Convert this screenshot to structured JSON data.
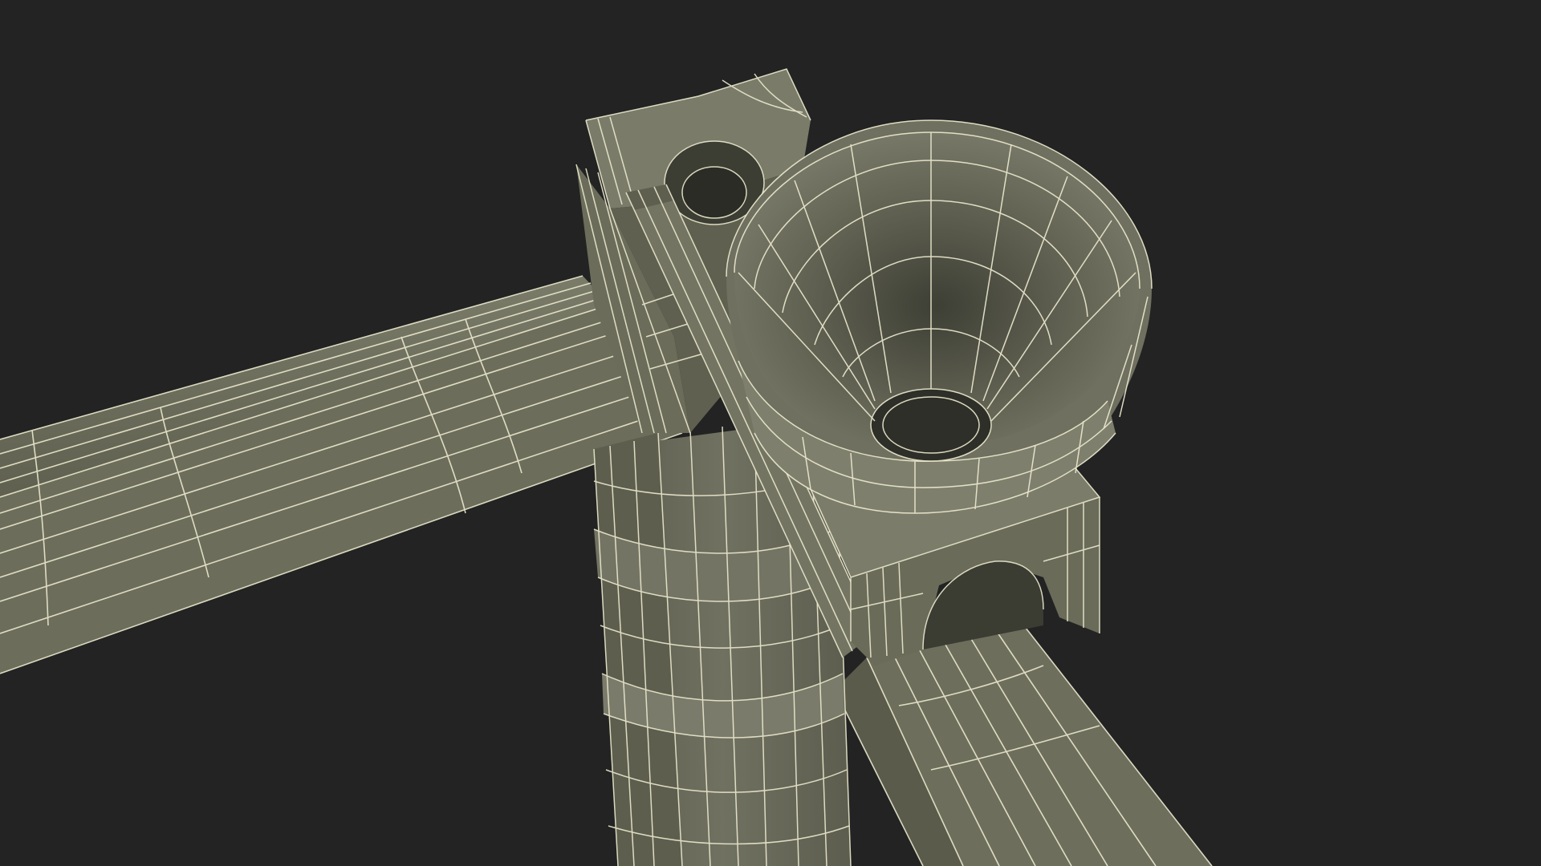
{
  "scene": {
    "subject": "wireframe-render",
    "colors": {
      "background": "#222322",
      "surface": "#6e6f5e",
      "surface_light": "#808170",
      "surface_dark": "#4c4d40",
      "wire": "#ece9cf"
    }
  }
}
